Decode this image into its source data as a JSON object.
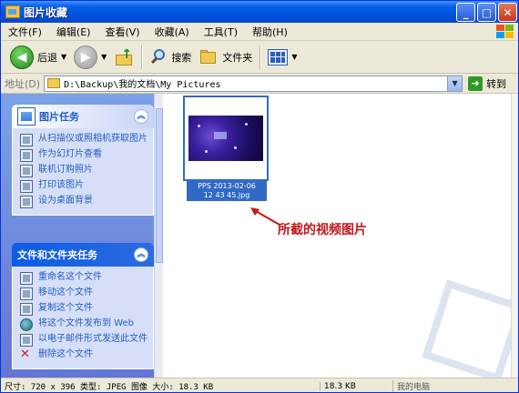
{
  "window": {
    "title": "图片收藏"
  },
  "menu": {
    "items": [
      "文件(F)",
      "编辑(E)",
      "查看(V)",
      "收藏(A)",
      "工具(T)",
      "帮助(H)"
    ]
  },
  "toolbar": {
    "back_label": "后退",
    "search_label": "搜索",
    "folders_label": "文件夹"
  },
  "address": {
    "label": "地址(D)",
    "path": "D:\\Backup\\我的文档\\My Pictures",
    "go_label": "转到"
  },
  "left_panel": {
    "picture_tasks": {
      "title": "图片任务",
      "items": [
        "从扫描仪或照相机获取图片",
        "作为幻灯片查看",
        "联机订购照片",
        "打印该图片",
        "设为桌面背景"
      ]
    },
    "file_tasks": {
      "title": "文件和文件夹任务",
      "items": [
        "重命名这个文件",
        "移动这个文件",
        "复制这个文件",
        "将这个文件发布到 Web",
        "以电子邮件形式发送此文件",
        "删除这个文件"
      ]
    }
  },
  "file": {
    "name_line1": "PPS 2013-02-06",
    "name_line2": "12 43 45.jpg"
  },
  "annotation": {
    "text": "所截的视频图片"
  },
  "status": {
    "main": "尺寸: 720 x 396 类型: JPEG 图像 大小: 18.3 KB",
    "size": "18.3 KB",
    "zone": "我的电脑"
  },
  "colors": {
    "title_blue": "#0054e3",
    "panel_link": "#215dc6",
    "annotation_red": "#c4161c",
    "selection": "#316ac5"
  }
}
